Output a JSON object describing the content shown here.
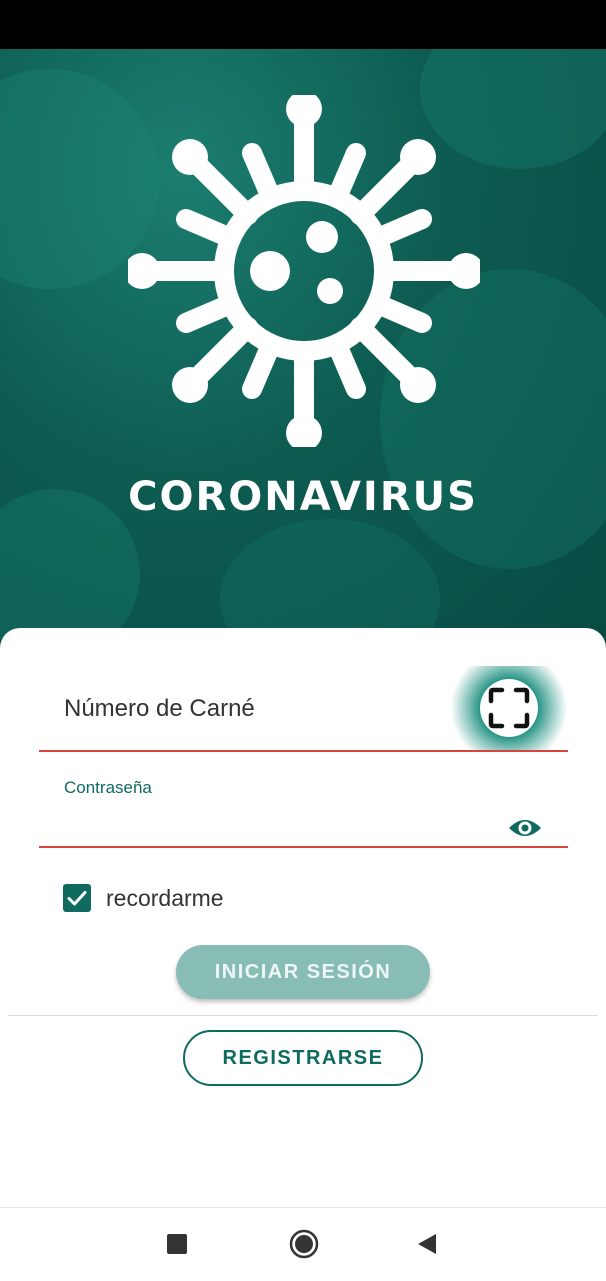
{
  "brand": {
    "title": "CORONAVIRUS",
    "logo_icon": "virus-icon",
    "hero_color": "#0d5b51"
  },
  "form": {
    "carne_field": {
      "value": "Número de Carné",
      "scan_icon": "scan-frame-icon"
    },
    "password_field": {
      "label": "Contraseña",
      "value": "",
      "toggle_icon": "eye-icon"
    },
    "remember": {
      "label": "recordarme",
      "checked": true
    },
    "login_button": "INICIAR SESIÓN",
    "register_button": "REGISTRARSE"
  },
  "navigation": {
    "recent_icon": "square-icon",
    "home_icon": "circle-icon",
    "back_icon": "triangle-back-icon"
  },
  "colors": {
    "accent": "#0f6b5f",
    "error_underline": "#d6453d",
    "login_button_disabled": "#88bdb5"
  }
}
